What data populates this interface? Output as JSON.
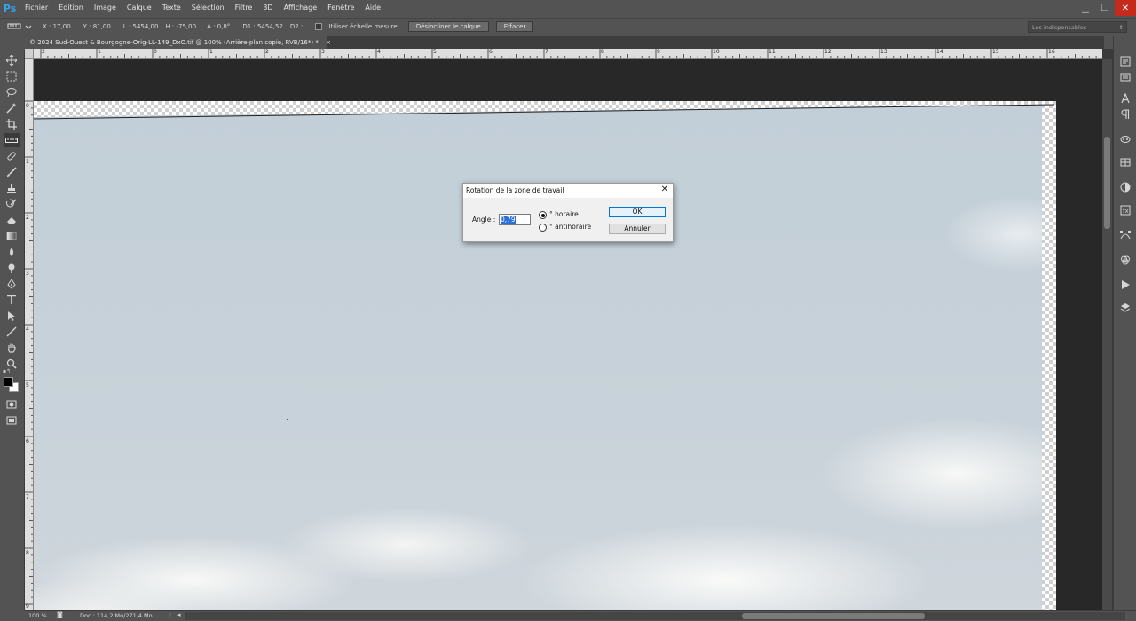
{
  "app": {
    "logo": "Ps"
  },
  "menu": [
    "Fichier",
    "Edition",
    "Image",
    "Calque",
    "Texte",
    "Sélection",
    "Filtre",
    "3D",
    "Affichage",
    "Fenêtre",
    "Aide"
  ],
  "window_controls": {
    "minimize": "▁",
    "restore": "❐",
    "close": "✕"
  },
  "options": {
    "tool_icon": "ruler-icon",
    "x": "X : 17,00",
    "y": "Y : 81,00",
    "l": "L : 5454,00",
    "h": "H : -75,00",
    "a": "A : 0,8°",
    "d1": "D1 : 5454,52",
    "d2": "D2 :",
    "use_scale": "Utiliser échelle mesure",
    "straighten_btn": "Désincliner le calque",
    "clear_btn": "Effacer",
    "workspace": "Les indispensables"
  },
  "document": {
    "tab_title": "© 2024 Sud-Ouest & Bourgogne-Orig-LL-149_DxO.tif @ 100% (Arrière-plan copie, RVB/16*) *",
    "tab_close": "×"
  },
  "rulers": {
    "top": [
      "2",
      "1",
      "0",
      "1",
      "2",
      "3",
      "4",
      "5",
      "6",
      "7",
      "8",
      "9",
      "10",
      "11",
      "12",
      "13",
      "14",
      "15",
      "16"
    ],
    "left": [
      "0",
      "1",
      "2",
      "3",
      "4",
      "5",
      "6",
      "7",
      "8",
      "9"
    ]
  },
  "status": {
    "zoom": "100 %",
    "doc": "Doc : 114,2 Mo/271,4 Mo"
  },
  "dialog": {
    "title": "Rotation de la zone de travail",
    "close": "✕",
    "angle_label": "Angle :",
    "angle_value": "0,79",
    "clockwise": "° horaire",
    "counterclockwise": "° antihoraire",
    "selected": "clockwise",
    "ok": "OK",
    "cancel": "Annuler"
  },
  "colors": {
    "foreground": "#000000",
    "background": "#ffffff",
    "accent": "#2fa6f3"
  }
}
